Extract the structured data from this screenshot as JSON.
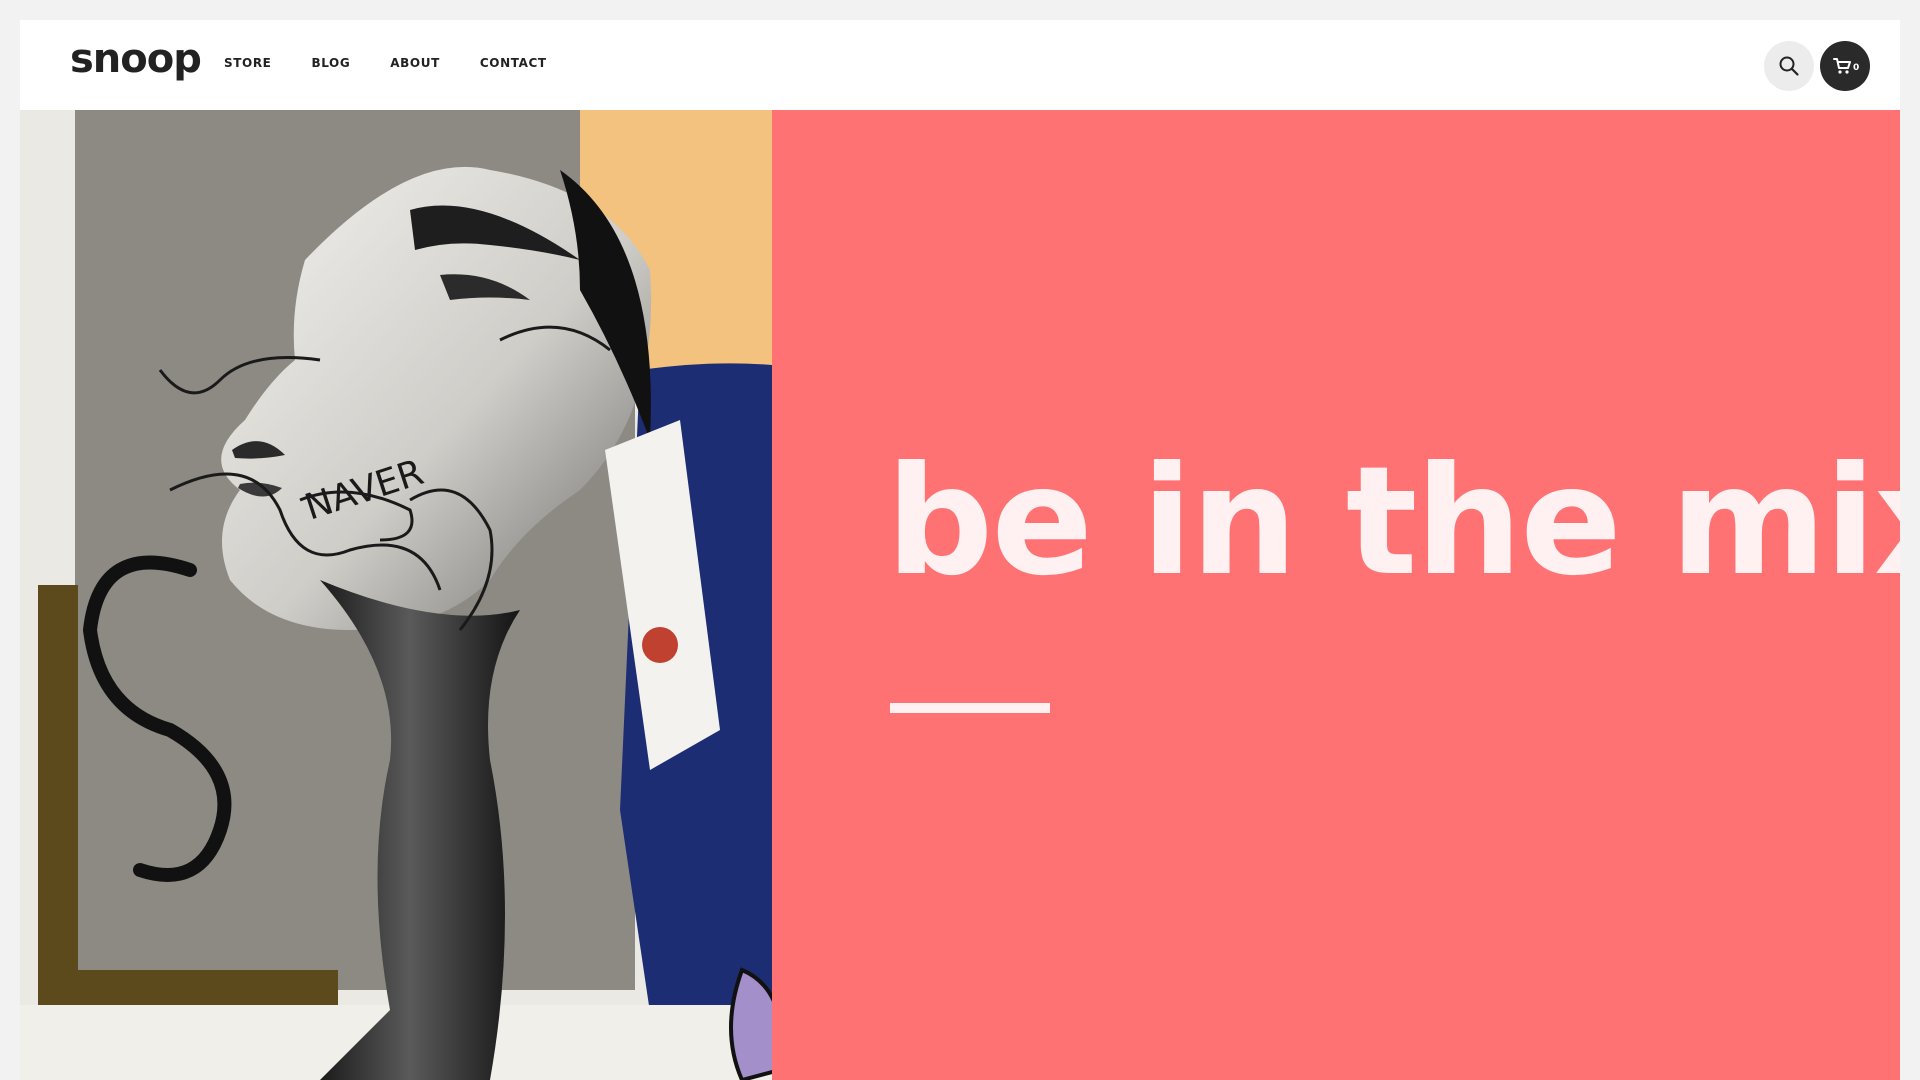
{
  "header": {
    "logo": "snoop",
    "nav": [
      {
        "label": "STORE"
      },
      {
        "label": "BLOG"
      },
      {
        "label": "ABOUT"
      },
      {
        "label": "CONTACT"
      }
    ],
    "search_icon": "search-icon",
    "cart_icon": "cart-icon",
    "cart_count": "0"
  },
  "hero": {
    "headline": "be in the mix",
    "image_description_icon": "street-art-image",
    "panel_color": "#ff7274",
    "text_color": "#fff0f1"
  }
}
